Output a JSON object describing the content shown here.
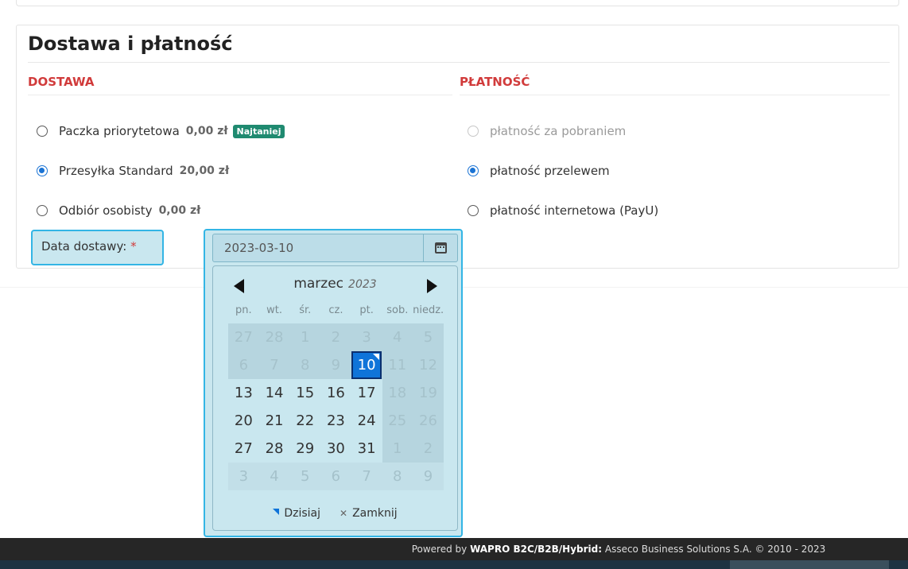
{
  "section": {
    "title": "Dostawa i płatność",
    "delivery_head": "DOSTAWA",
    "payment_head": "PŁATNOŚĆ"
  },
  "delivery_options": [
    {
      "label": "Paczka priorytetowa",
      "price": "0,00 zł",
      "badge": "Najtaniej",
      "checked": false
    },
    {
      "label": "Przesyłka Standard",
      "price": "20,00 zł",
      "checked": true
    },
    {
      "label": "Odbiór osobisty",
      "price": "0,00 zł",
      "checked": false
    }
  ],
  "payment_options": [
    {
      "label": "płatność za pobraniem",
      "checked": false,
      "disabled": true
    },
    {
      "label": "płatność przelewem",
      "checked": true
    },
    {
      "label": "płatność internetowa (PayU)",
      "checked": false
    }
  ],
  "date_field": {
    "label": "Data dostawy:",
    "required_mark": "*",
    "value": "2023-03-10"
  },
  "calendar": {
    "month": "marzec",
    "year": "2023",
    "weekdays": [
      "pn.",
      "wt.",
      "śr.",
      "cz.",
      "pt.",
      "sob.",
      "niedz."
    ],
    "weeks": [
      [
        "27",
        "28",
        "1",
        "2",
        "3",
        "4",
        "5"
      ],
      [
        "6",
        "7",
        "8",
        "9",
        "10",
        "11",
        "12"
      ],
      [
        "13",
        "14",
        "15",
        "16",
        "17",
        "18",
        "19"
      ],
      [
        "20",
        "21",
        "22",
        "23",
        "24",
        "25",
        "26"
      ],
      [
        "27",
        "28",
        "29",
        "30",
        "31",
        "1",
        "2"
      ],
      [
        "3",
        "4",
        "5",
        "6",
        "7",
        "8",
        "9"
      ]
    ],
    "selected": "10",
    "today_label": "Dzisiaj",
    "close_label": "Zamknij",
    "accent": "#0f74d9"
  },
  "footer": {
    "prefix": "Powered by ",
    "brand": "WAPRO B2C/B2B/Hybrid:",
    "rest": " Asseco Business Solutions S.A. © 2010 - 2023"
  },
  "colors": {
    "section_head": "#d13b3b",
    "highlight_border": "#33b5e5",
    "badge": "#1f8a70"
  }
}
